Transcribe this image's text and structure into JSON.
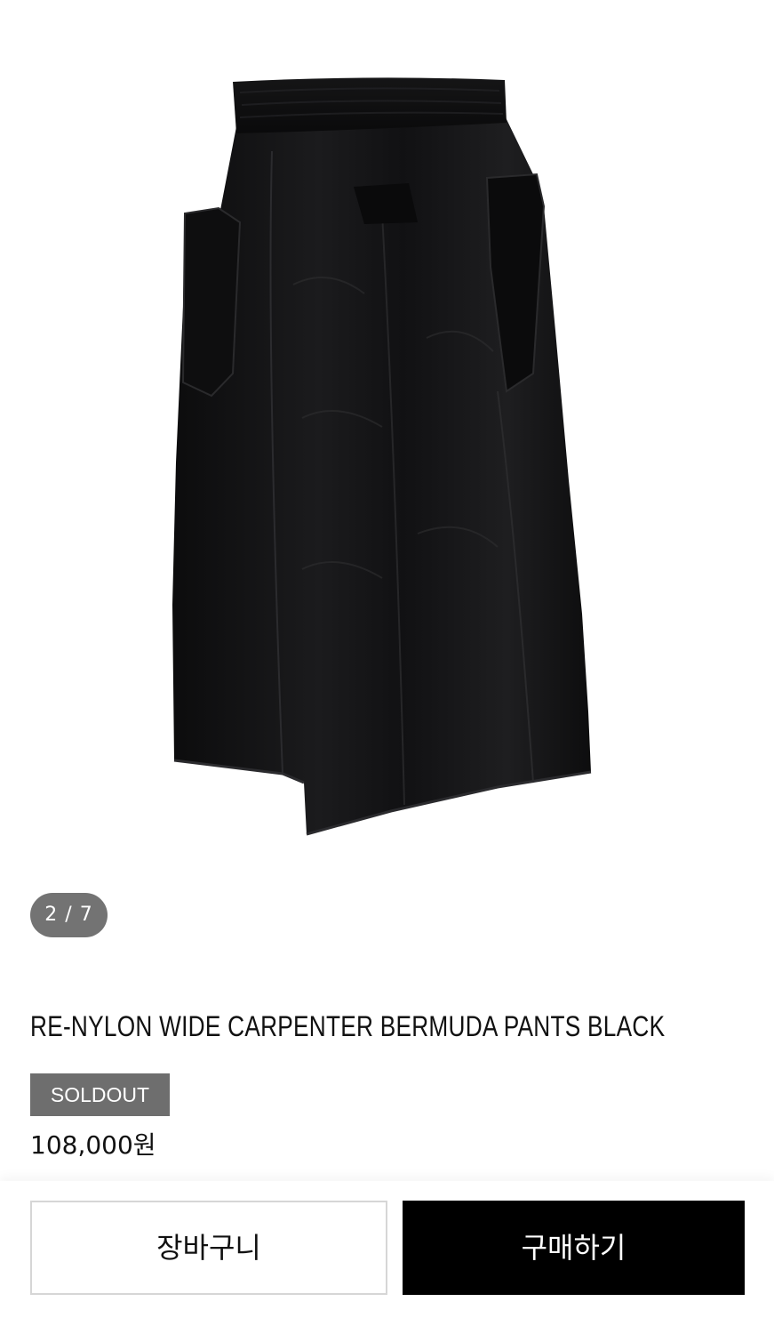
{
  "gallery": {
    "image_alt": "RE-NYLON WIDE CARPENTER BERMUDA PANTS BLACK",
    "counter": "2 / 7"
  },
  "product": {
    "title": "RE-NYLON WIDE CARPENTER BERMUDA PANTS BLACK",
    "badge": "SOLDOUT",
    "price": "108,000원"
  },
  "actions": {
    "cart_label": "장바구니",
    "buy_label": "구매하기"
  },
  "colors": {
    "buy_button": "#000000",
    "badge": "#6e6e6e",
    "counter_pill": "#737373"
  }
}
